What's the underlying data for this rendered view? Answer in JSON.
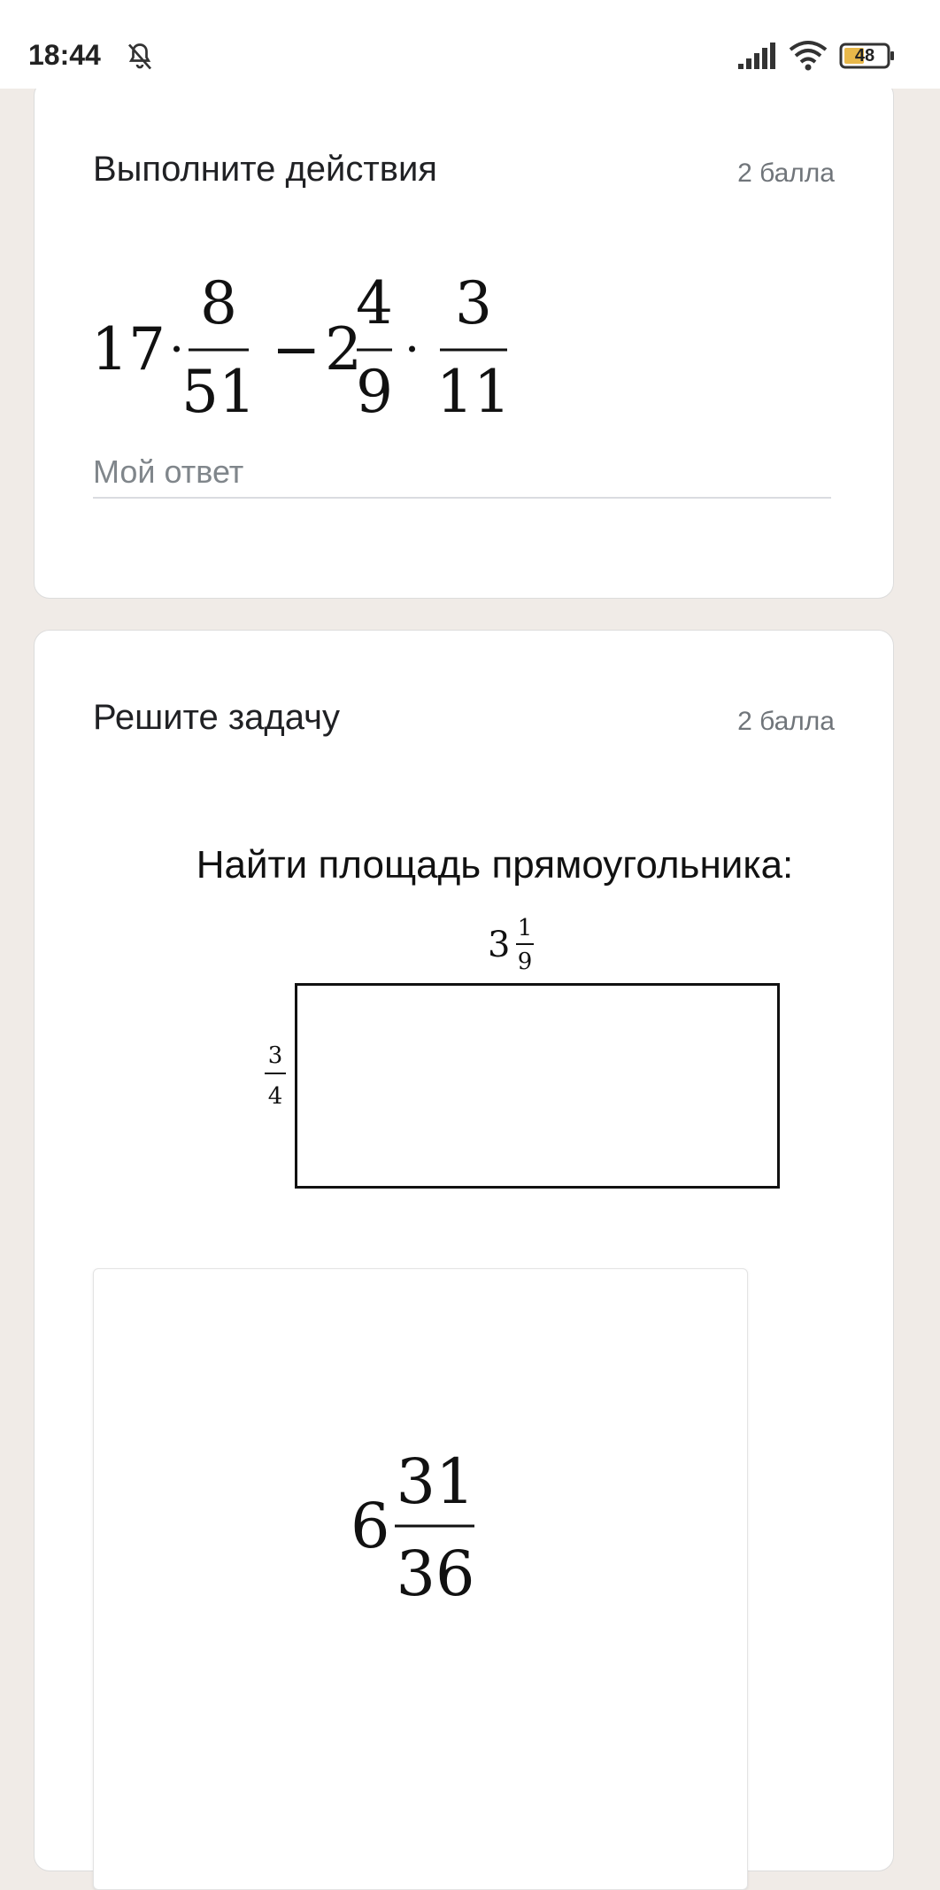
{
  "status_bar": {
    "time": "18:44",
    "battery": "48",
    "icons": [
      "bell-muted-icon",
      "signal-icon",
      "wifi-icon",
      "battery-icon"
    ]
  },
  "questions": [
    {
      "title": "Выполните действия",
      "points": "2 балла",
      "expression": {
        "term1_whole": "17",
        "dot": "·",
        "frac1_num": "8",
        "frac1_den": "51",
        "minus": "−",
        "term2_whole": "2",
        "frac2_num": "4",
        "frac2_den": "9",
        "frac3_num": "3",
        "frac3_den": "11"
      },
      "answer_placeholder": "Мой ответ",
      "answer_value": ""
    },
    {
      "title": "Решите задачу",
      "points": "2 балла",
      "task": {
        "text": "Найти площадь прямоугольника:",
        "top_whole": "3",
        "top_num": "1",
        "top_den": "9",
        "left_num": "3",
        "left_den": "4"
      },
      "option": {
        "whole": "6",
        "num": "31",
        "den": "36"
      }
    }
  ],
  "colors": {
    "background": "#f0ebe7",
    "card": "#ffffff",
    "title_text": "#202124",
    "muted_text": "#70757a"
  }
}
